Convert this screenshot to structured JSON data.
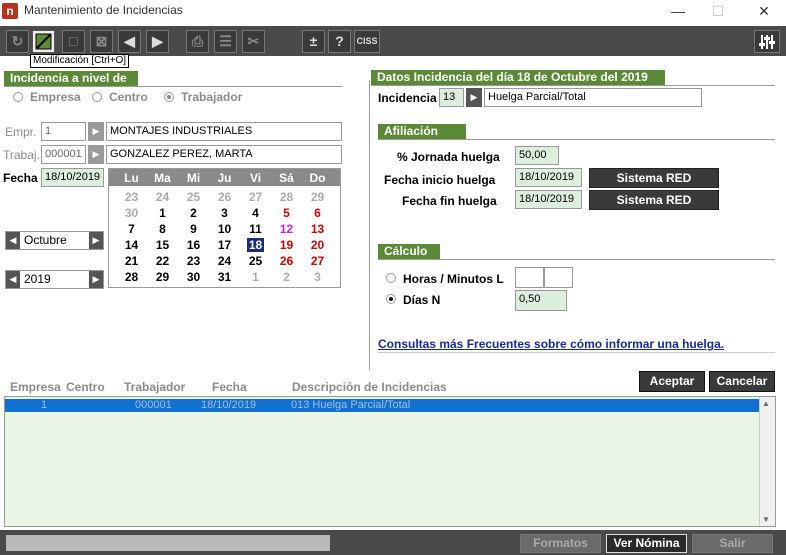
{
  "window": {
    "title": "Mantenimiento de Incidencias",
    "app_icon": "n",
    "minimize": "—",
    "maximize": "☐",
    "close": "✕"
  },
  "toolbar": {
    "tooltip": "Modificación [Ctrl+O]",
    "ciss_label": "CISS",
    "plusminus_label": "±",
    "help_label": "?"
  },
  "incidencia_nivel": {
    "header": "Incidencia a nivel de",
    "options": [
      "Empresa",
      "Centro",
      "Trabajador"
    ],
    "selected": "Trabajador"
  },
  "empresa": {
    "label": "Empr.",
    "code": "1",
    "name": "MONTAJES INDUSTRIALES"
  },
  "trabajador": {
    "label": "Trabaj.",
    "code": "000001",
    "name": "GONZALEZ PEREZ, MARTA"
  },
  "fecha": {
    "label": "Fecha",
    "value": "18/10/2019"
  },
  "calendar": {
    "weekdays": [
      "Lu",
      "Ma",
      "Mi",
      "Ju",
      "Vi",
      "Sá",
      "Do"
    ],
    "weeks": [
      [
        "23",
        "24",
        "25",
        "26",
        "27",
        "28",
        "29"
      ],
      [
        "30",
        "1",
        "2",
        "3",
        "4",
        "5",
        "6"
      ],
      [
        "7",
        "8",
        "9",
        "10",
        "11",
        "12",
        "13"
      ],
      [
        "14",
        "15",
        "16",
        "17",
        "18",
        "19",
        "20"
      ],
      [
        "21",
        "22",
        "23",
        "24",
        "25",
        "26",
        "27"
      ],
      [
        "28",
        "29",
        "30",
        "31",
        "1",
        "2",
        "3"
      ]
    ],
    "selected_day": "18",
    "month": "Octubre",
    "year": "2019"
  },
  "datos": {
    "header": "Datos Incidencia del día 18 de Octubre del 2019",
    "incidencia_label": "Incidencia",
    "incidencia_code": "13",
    "incidencia_desc": "Huelga Parcial/Total"
  },
  "afiliacion": {
    "header": "Afiliación",
    "jornada_label": "% Jornada huelga",
    "jornada_value": "50,00",
    "inicio_label": "Fecha inicio huelga",
    "inicio_value": "18/10/2019",
    "fin_label": "Fecha fin huelga",
    "fin_value": "18/10/2019",
    "sistema_red_label": "Sistema RED"
  },
  "calculo": {
    "header": "Cálculo",
    "horas_label": "Horas / Minutos L",
    "horas_value": "",
    "minutos_value": "",
    "dias_label": "Días N",
    "dias_value": "0,50",
    "selected": "Días N"
  },
  "help_link": "Consultas más Frecuentes sobre cómo informar una huelga.",
  "list": {
    "columns": [
      "Empresa",
      "Centro",
      "Trabajador",
      "Fecha",
      "Descripción de Incidencias"
    ],
    "rows": [
      {
        "empresa": "1",
        "centro": "",
        "trabajador": "000001",
        "fecha": "18/10/2019",
        "descripcion": "013 Huelga Parcial/Total"
      }
    ]
  },
  "buttons": {
    "aceptar": "Aceptar",
    "cancelar": "Cancelar",
    "formatos": "Formatos",
    "ver_nomina": "Ver Nómina",
    "salir": "Salir"
  },
  "colors": {
    "section_green": "#5b8a36",
    "toolbar_dark": "#4a4a4a",
    "grid_bg": "#eaf5e6",
    "selection_blue": "#1170d0",
    "link_blue": "#1a2a9a",
    "weekend_red": "#cc0000",
    "holiday_magenta": "#d020d0"
  }
}
